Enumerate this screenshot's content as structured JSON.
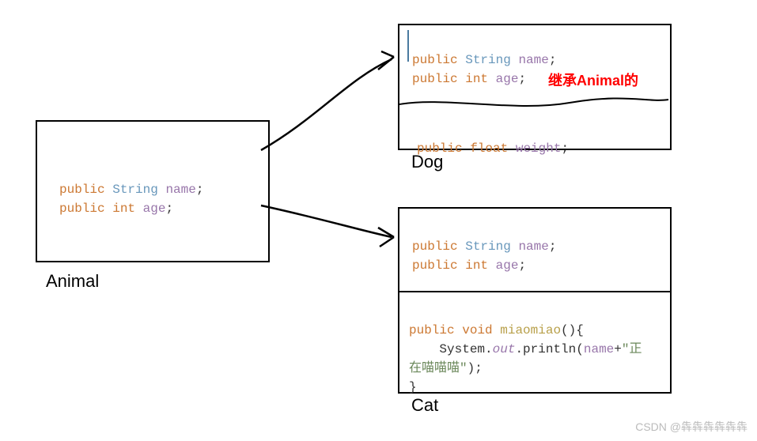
{
  "animal": {
    "label": "Animal",
    "line1_kw": "public",
    "line1_type": "String",
    "line1_id": "name",
    "line1_end": ";",
    "line2_kw": "public",
    "line2_type": "int",
    "line2_id": "age",
    "line2_end": ";"
  },
  "dog": {
    "label": "Dog",
    "inherit_note": "继承Animal的",
    "line1_kw": "public",
    "line1_type": "String",
    "line1_id": "name",
    "line1_end": ";",
    "line2_kw": "public",
    "line2_type": "int",
    "line2_id": "age",
    "line2_end": ";",
    "line3_kw": "public",
    "line3_type": "float",
    "line3_id": "weight",
    "line3_end": ";"
  },
  "cat": {
    "label": "Cat",
    "line1_kw": "public",
    "line1_type": "String",
    "line1_id": "name",
    "line1_end": ";",
    "line2_kw": "public",
    "line2_type": "int",
    "line2_id": "age",
    "line2_end": ";",
    "m_kw": "public",
    "m_ret": "void",
    "m_name": "miaomiao",
    "m_paren": "(){",
    "m_call1": "System.",
    "m_call2": "out",
    "m_call3": ".println(",
    "m_arg": "name",
    "m_plus": "+",
    "m_str1": "\"正",
    "m_str2": "在喵喵喵\"",
    "m_close": ");",
    "m_brace": "}"
  },
  "watermark": "CSDN @犇犇犇犇犇犇"
}
